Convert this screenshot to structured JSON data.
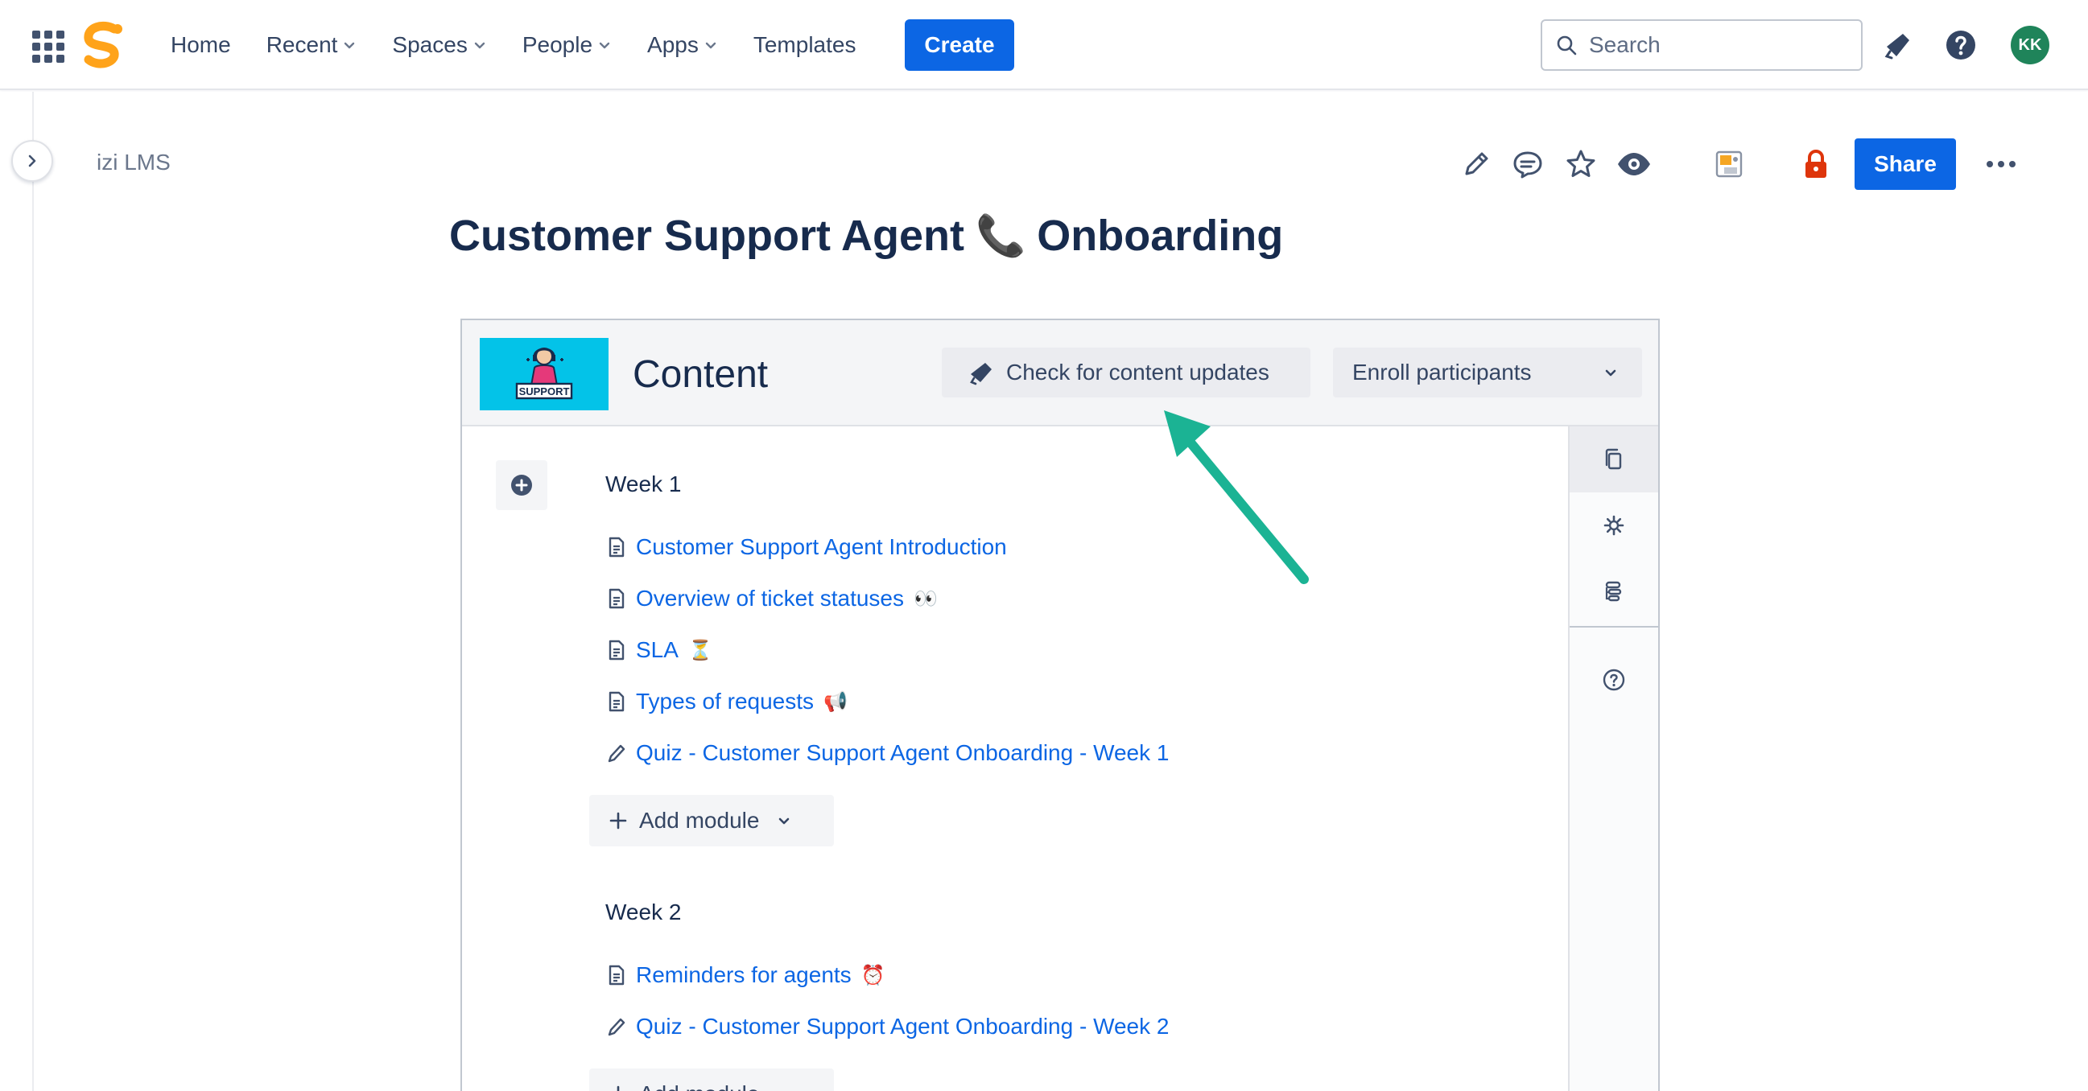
{
  "nav": {
    "items": [
      {
        "label": "Home",
        "has_menu": false
      },
      {
        "label": "Recent",
        "has_menu": true
      },
      {
        "label": "Spaces",
        "has_menu": true
      },
      {
        "label": "People",
        "has_menu": true
      },
      {
        "label": "Apps",
        "has_menu": true
      },
      {
        "label": "Templates",
        "has_menu": false
      }
    ],
    "create_label": "Create",
    "search_placeholder": "Search",
    "avatar_initials": "KK",
    "accent": "#0c66e4",
    "avatar_color": "#1f845a",
    "logo_color": "#ffa31a"
  },
  "page": {
    "breadcrumb": "izi LMS",
    "title_before": "Customer Support Agent",
    "title_emoji": "📞",
    "title_after": "Onboarding",
    "share_label": "Share"
  },
  "macro": {
    "thumbnail_text": "SUPPORT",
    "title": "Content",
    "check_updates_label": "Check for content updates",
    "enroll_label": "Enroll participants",
    "thumbnail_color": "#03c3e8",
    "sections": [
      {
        "title": "Week 1",
        "modules": [
          {
            "type": "page",
            "label": "Customer Support Agent Introduction",
            "emoji": ""
          },
          {
            "type": "page",
            "label": "Overview of ticket statuses",
            "emoji": "👀"
          },
          {
            "type": "page",
            "label": "SLA",
            "emoji": "⏳"
          },
          {
            "type": "page",
            "label": "Types of requests",
            "emoji": "📢"
          },
          {
            "type": "quiz",
            "label": "Quiz - Customer Support Agent Onboarding - Week 1",
            "emoji": ""
          }
        ],
        "add_module_label": "Add module"
      },
      {
        "title": "Week 2",
        "modules": [
          {
            "type": "page",
            "label": "Reminders for agents",
            "emoji": "⏰"
          },
          {
            "type": "quiz",
            "label": "Quiz - Customer Support Agent Onboarding - Week 2",
            "emoji": ""
          }
        ],
        "add_module_label": "Add module"
      }
    ]
  },
  "annotation": {
    "arrow_color": "#1bb394"
  }
}
